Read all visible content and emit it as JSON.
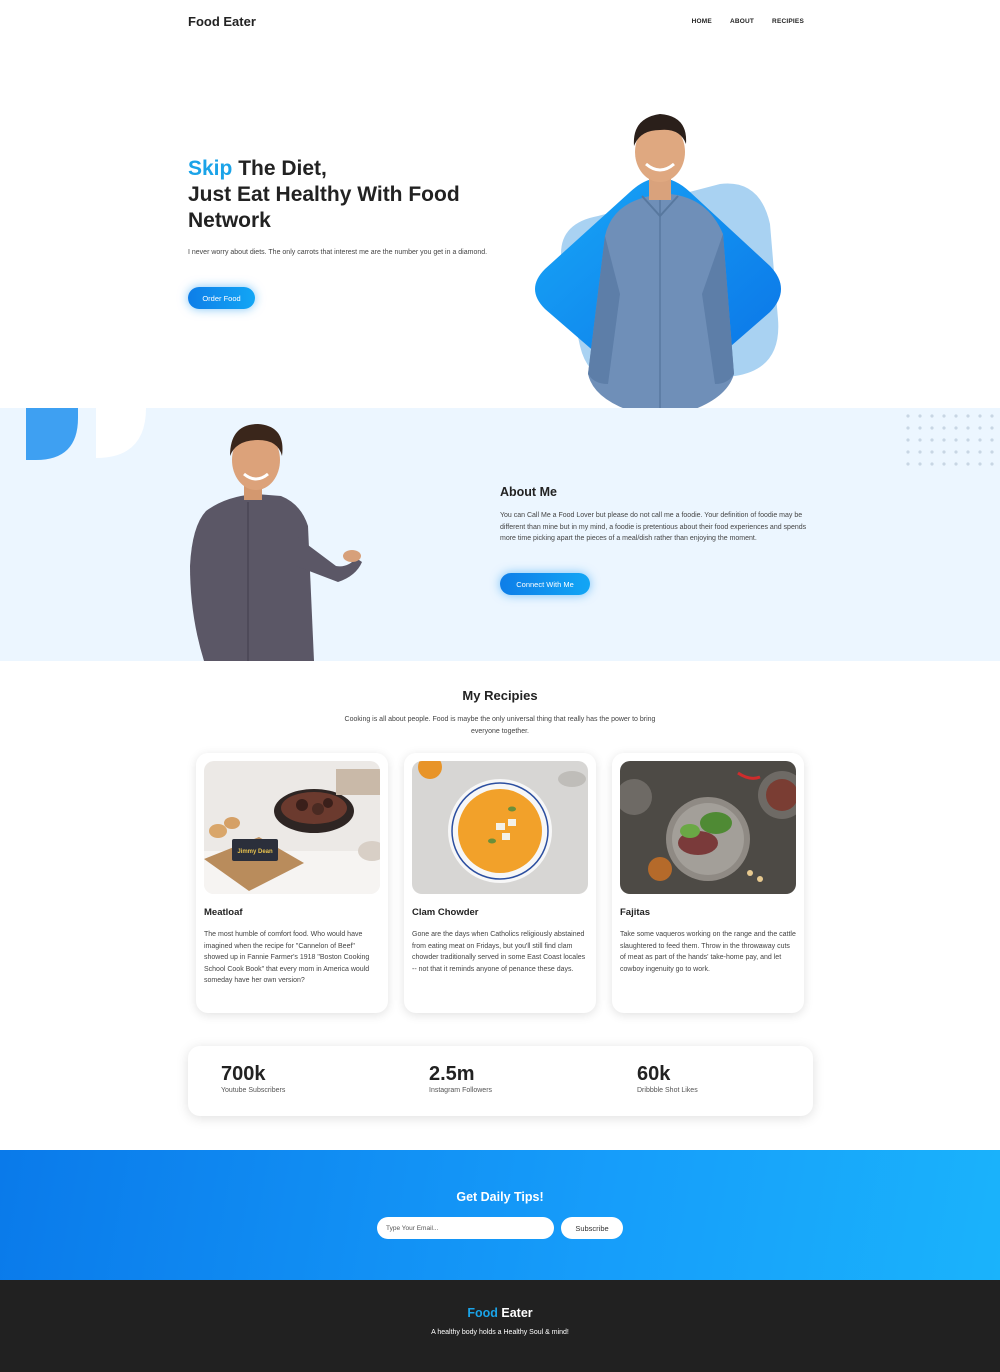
{
  "nav": {
    "logo": "Food Eater",
    "items": [
      {
        "label": "HOME"
      },
      {
        "label": "ABOUT"
      },
      {
        "label": "RECIPIES"
      }
    ]
  },
  "hero": {
    "title_accent": "Skip",
    "title_rest_line1": " The Diet,",
    "title_line2": "Just Eat Healthy With Food",
    "title_line3": "Network",
    "description": "I never worry about diets. The only carrots that interest me are the number you get in a diamond.",
    "button_label": "Order Food"
  },
  "about": {
    "title": "About Me",
    "text": "You can Call Me a Food Lover but please do not call me a foodie. Your definition of foodie may be different than mine but in my mind, a foodie is pretentious about their food experiences and spends more time picking apart the pieces of a meal/dish rather than enjoying the moment.",
    "button_label": "Connect With Me"
  },
  "recipes": {
    "title": "My Recipies",
    "subtitle": "Cooking is all about people. Food is maybe the only universal thing that really has the power to bring everyone together.",
    "cards": [
      {
        "title": "Meatloaf",
        "text": "The most humble of comfort food. Who would have imagined when the recipe for \"Cannelon of Beef\" showed up in Fannie Farmer's 1918 \"Boston Cooking School Cook Book\" that every mom in America would someday have her own version?",
        "package_label": "Jimmy Dean"
      },
      {
        "title": "Clam Chowder",
        "text": "Gone are the days when Catholics religiously abstained from eating meat on Fridays, but you'll still find clam chowder traditionally served in some East Coast locales -- not that it reminds anyone of penance these days."
      },
      {
        "title": "Fajitas",
        "text": "Take some vaqueros working on the range and the cattle slaughtered to feed them. Throw in the throwaway cuts of meat as part of the hands' take-home pay, and let cowboy ingenuity go to work."
      }
    ]
  },
  "stats": [
    {
      "value": "700k",
      "label": "Youtube Subscribers"
    },
    {
      "value": "2.5m",
      "label": "Instagram Followers"
    },
    {
      "value": "60k",
      "label": "Dribbble Shot Likes"
    }
  ],
  "newsletter": {
    "title": "Get Daily Tips!",
    "email_placeholder": "Type Your Email...",
    "button_label": "Subscribe"
  },
  "footer": {
    "logo_accent": "Food",
    "logo_rest": " Eater",
    "tagline": "A healthy body holds a Healthy Soul & mind!"
  },
  "colors": {
    "accent": "#1aa3e8",
    "button_gradient_start": "#0e7ee8",
    "button_gradient_end": "#12a6f5",
    "about_bg": "#ecf6ff",
    "footer_bg": "#212121"
  }
}
